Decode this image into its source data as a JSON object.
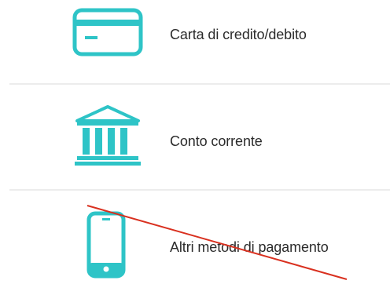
{
  "payment_methods": [
    {
      "label": "Carta di credito/debito",
      "icon": "credit-card-icon"
    },
    {
      "label": "Conto corrente",
      "icon": "bank-icon"
    },
    {
      "label": "Altri metodi di pagamento",
      "icon": "smartphone-icon"
    }
  ],
  "colors": {
    "accent": "#2ec4c7",
    "text": "#2b2b2b",
    "divider": "#ececec",
    "strike": "#d9301f"
  }
}
